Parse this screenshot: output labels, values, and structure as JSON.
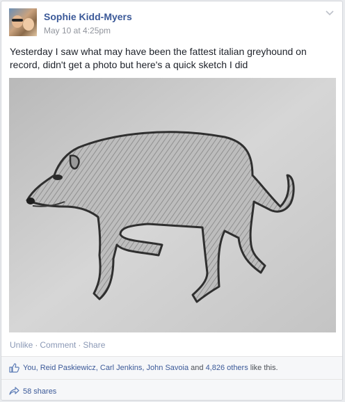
{
  "post": {
    "author": "Sophie Kidd-Myers",
    "timestamp": "May 10 at 4:25pm",
    "text": "Yesterday I saw what may have been the fattest italian greyhound on record, didn't get a photo but here's a quick sketch I did",
    "photo_subject": "pencil sketch of a fat italian greyhound"
  },
  "actions": {
    "unlike": "Unlike",
    "separator": "·",
    "comment": "Comment",
    "share": "Share"
  },
  "likes": {
    "you": "You,",
    "person1": "Reid Paskiewicz,",
    "person2": "Carl Jenkins,",
    "person3": "John Savoia",
    "and": "and",
    "others": "4,826 others",
    "suffix": "like this."
  },
  "shares": {
    "label": "58 shares"
  },
  "icons": {
    "menu": "chevron-down-icon",
    "like": "thumbs-up-icon",
    "share": "share-arrow-icon"
  },
  "colors": {
    "link": "#3b5998",
    "muted": "#90949c",
    "action_link": "#8a98b5",
    "footer_bg": "#f6f7f9"
  }
}
